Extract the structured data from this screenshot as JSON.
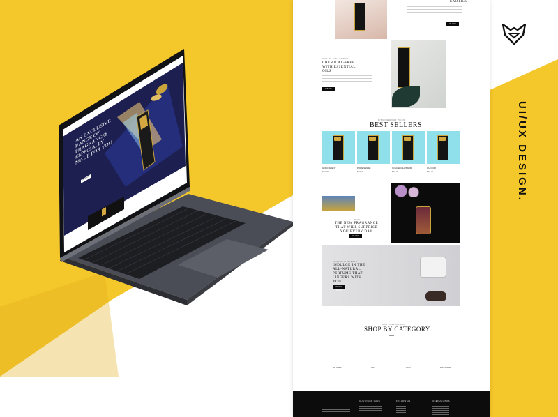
{
  "brand": {
    "logo_text": "UI/UX DESIGN.",
    "accent": "#f4c72b"
  },
  "laptop_screen": {
    "hero_headline": "AN EXCLUSIVE RANGE OF FRAGRANCES ESPECIALLY MADE FOR YOU",
    "hero_button": "SHOP NOW"
  },
  "site": {
    "exotics": {
      "title": "EXOTICS",
      "button": "SHOP NOW"
    },
    "essential_oils": {
      "kicker": "OUR OIL COLLECTION",
      "title": "CHEMICAL-FREE WITH ESSENTIAL OILS",
      "button": "READ MORE"
    },
    "best_sellers": {
      "kicker": "DISCOVER OUR PICKS",
      "title": "BEST SELLERS",
      "products": [
        {
          "name": "GOLD SCENT",
          "price": "$50.00"
        },
        {
          "name": "PURE SENSE",
          "price": "$50.00"
        },
        {
          "name": "GOLDEN BLOSSOM",
          "price": "$50.00"
        },
        {
          "name": "OUD OIR",
          "price": "$50.00"
        }
      ]
    },
    "new_fragrance": {
      "kicker": "NEW",
      "title": "THE NEW FRAGRANCE THAT WILL SURPRISE YOU EVERY DAY",
      "button": "SHOP NOW"
    },
    "lingering": {
      "kicker": "LONGEVITY SCENTS",
      "title": "INDULGE IN THE ALL-NATURAL PERFUME THAT LINGERS WITH YOU",
      "button": "SHOP NOW"
    },
    "shop_by_category": {
      "kicker": "OUR COLLECTIONS",
      "title": "SHOP BY CATEGORY",
      "categories": [
        "ATTARS",
        "OIL",
        "OUD",
        "DIFFUSER"
      ]
    },
    "footer": {
      "col1": "CUSTOMER CARE",
      "col2": "FOLLOW US",
      "col3": "USEFUL LINKS"
    }
  }
}
